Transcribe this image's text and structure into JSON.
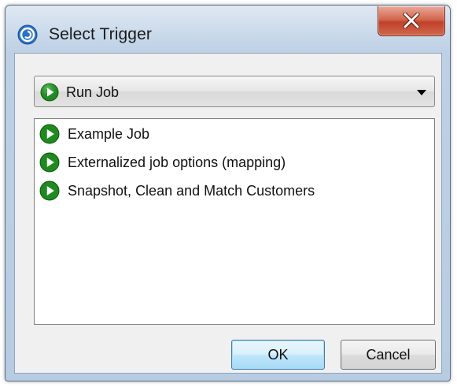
{
  "window": {
    "title": "Select Trigger",
    "close_symbol": "X"
  },
  "trigger_type": {
    "selected": "Run Job",
    "icon": "run-job-icon"
  },
  "jobs": [
    {
      "label": "Example Job",
      "icon": "run-job-icon"
    },
    {
      "label": "Externalized job options (mapping)",
      "icon": "run-job-icon"
    },
    {
      "label": "Snapshot, Clean and Match Customers",
      "icon": "run-job-icon"
    }
  ],
  "buttons": {
    "ok": "OK",
    "cancel": "Cancel"
  },
  "colors": {
    "run_icon_green": "#1f8a1f",
    "close_red": "#c2402a",
    "default_button_border": "#3c7fb1"
  }
}
